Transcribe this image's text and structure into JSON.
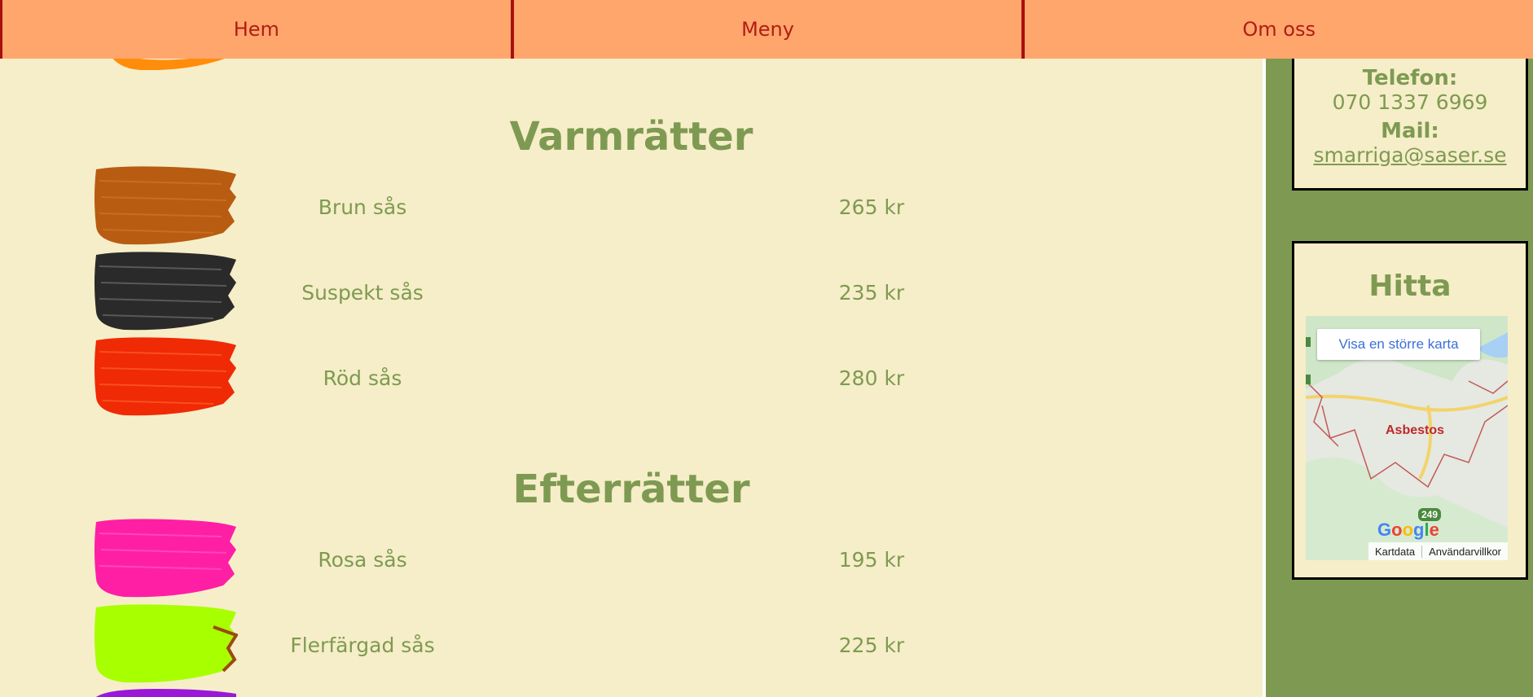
{
  "nav": {
    "items": [
      {
        "label": "Hem"
      },
      {
        "label": "Meny"
      },
      {
        "label": "Om oss"
      }
    ]
  },
  "menu": {
    "categories": [
      {
        "title": "Varmrätter",
        "items": [
          {
            "name": "Brun sås",
            "price": "265 kr",
            "color": "#b85c12"
          },
          {
            "name": "Suspekt sås",
            "price": "235 kr",
            "color": "#2a2a2a"
          },
          {
            "name": "Röd sås",
            "price": "280 kr",
            "color": "#ef2a05"
          }
        ]
      },
      {
        "title": "Efterrätter",
        "items": [
          {
            "name": "Rosa sås",
            "price": "195 kr",
            "color": "#ff1fa5"
          },
          {
            "name": "Flerfärgad sås",
            "price": "225 kr",
            "color": "#a8ff00"
          }
        ]
      }
    ],
    "partial_brush_colors": {
      "top": "#ff8c0a",
      "bottom": "#9a18d8"
    }
  },
  "contact": {
    "phone_label": "Telefon:",
    "phone_value": "070 1337 6969",
    "mail_label": "Mail:",
    "mail_value": "smarriga@saser.se"
  },
  "find": {
    "title": "Hitta",
    "map_button": "Visa en större karta",
    "map_city": "Asbestos",
    "map_route": "249",
    "map_footer": [
      "Kartdata",
      "Användarvillkor"
    ]
  },
  "colors": {
    "background": "#f6eec8",
    "text": "#7e9a52",
    "nav_bg": "#ffa66d",
    "nav_text": "#b01d14",
    "sidebar_bg": "#7e9a52"
  }
}
